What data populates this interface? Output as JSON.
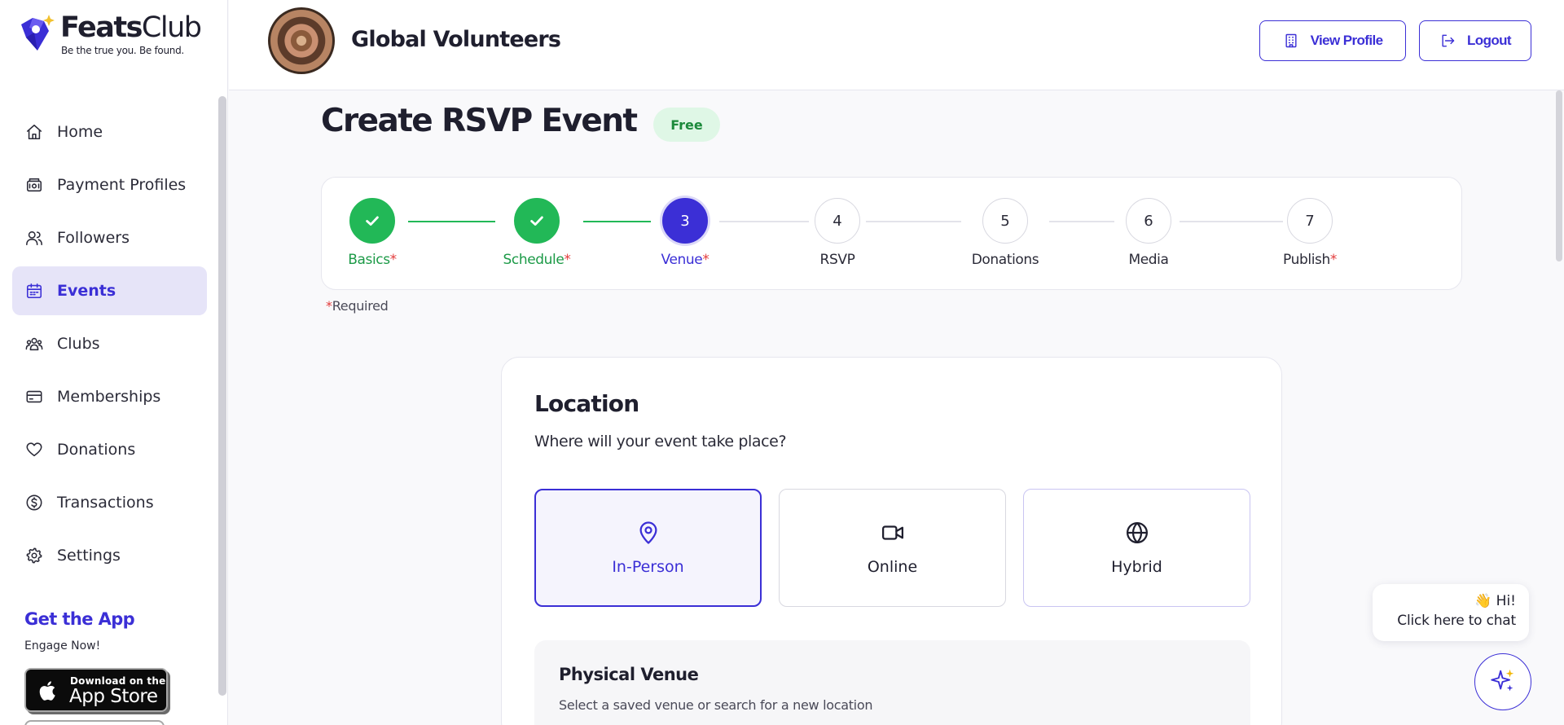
{
  "brand": {
    "name_bold": "Feats",
    "name_light": "Club",
    "tagline": "Be the true you. Be found.",
    "accent_color": "#3b2fd6",
    "success_color": "#22b857"
  },
  "sidebar": {
    "items": [
      {
        "label": "Home",
        "icon": "home-icon",
        "active": false
      },
      {
        "label": "Payment Profiles",
        "icon": "wallet-icon",
        "active": false
      },
      {
        "label": "Followers",
        "icon": "users-icon",
        "active": false
      },
      {
        "label": "Events",
        "icon": "calendar-icon",
        "active": true
      },
      {
        "label": "Clubs",
        "icon": "group-icon",
        "active": false
      },
      {
        "label": "Memberships",
        "icon": "card-icon",
        "active": false
      },
      {
        "label": "Donations",
        "icon": "heart-icon",
        "active": false
      },
      {
        "label": "Transactions",
        "icon": "dollar-circle-icon",
        "active": false
      },
      {
        "label": "Settings",
        "icon": "gear-icon",
        "active": false
      }
    ],
    "get_app_title": "Get the App",
    "get_app_sub": "Engage Now!",
    "appstore_small": "Download on the",
    "appstore_big": "App Store"
  },
  "header": {
    "org_name": "Global Volunteers",
    "view_profile_label": "View Profile",
    "logout_label": "Logout"
  },
  "page": {
    "title": "Create RSVP Event",
    "badge": "Free",
    "required_note": "Required"
  },
  "stepper": {
    "steps": [
      {
        "number": "1",
        "label": "Basics",
        "state": "done",
        "required": true
      },
      {
        "number": "2",
        "label": "Schedule",
        "state": "done",
        "required": true
      },
      {
        "number": "3",
        "label": "Venue",
        "state": "current",
        "required": true
      },
      {
        "number": "4",
        "label": "RSVP",
        "state": "todo",
        "required": false
      },
      {
        "number": "5",
        "label": "Donations",
        "state": "todo",
        "required": false
      },
      {
        "number": "6",
        "label": "Media",
        "state": "todo",
        "required": false
      },
      {
        "number": "7",
        "label": "Publish",
        "state": "todo",
        "required": true
      }
    ]
  },
  "location": {
    "title": "Location",
    "subtitle": "Where will your event take place?",
    "options": [
      {
        "label": "In-Person",
        "icon": "map-pin-icon",
        "selected": true
      },
      {
        "label": "Online",
        "icon": "video-icon",
        "selected": false
      },
      {
        "label": "Hybrid",
        "icon": "globe-icon",
        "selected": false
      }
    ],
    "venue_title": "Physical Venue",
    "venue_subtitle": "Select a saved venue or search for a new location"
  },
  "chat": {
    "greeting": "👋 Hi!",
    "prompt": "Click here to chat"
  }
}
